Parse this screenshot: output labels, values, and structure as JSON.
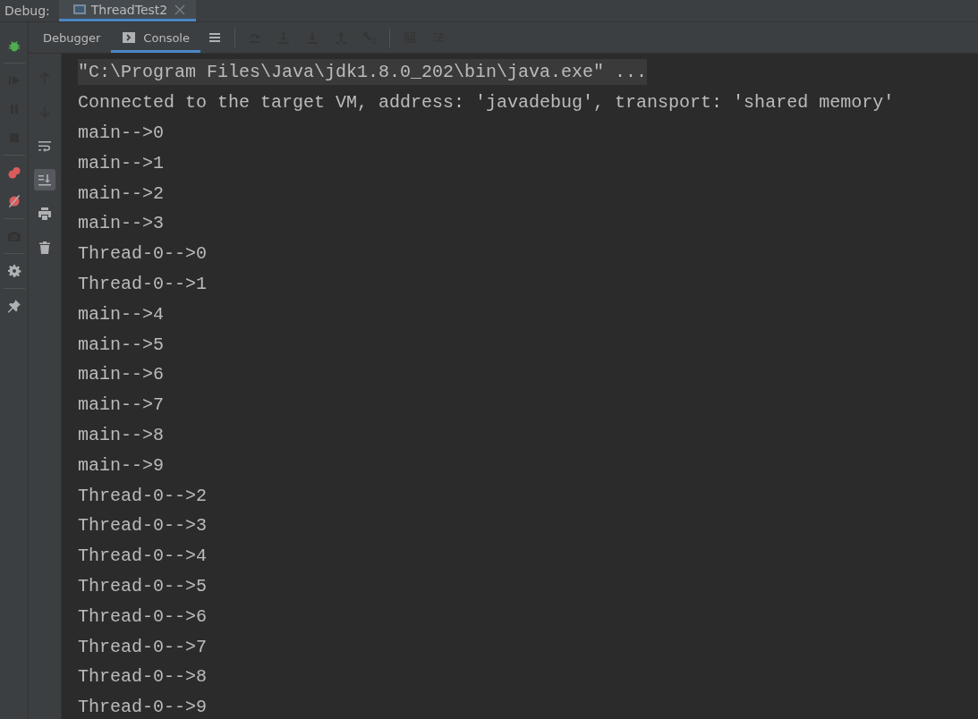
{
  "header": {
    "label": "Debug:",
    "tabs": [
      {
        "label": "ThreadTest2",
        "selected": true
      }
    ]
  },
  "tool_tabs": [
    {
      "kind": "debugger",
      "label": "Debugger",
      "selected": false
    },
    {
      "kind": "console",
      "label": "Console",
      "selected": true
    }
  ],
  "toolbar": [
    {
      "kind": "menu",
      "disabled": false
    },
    {
      "kind": "sep"
    },
    {
      "kind": "step-over",
      "disabled": true
    },
    {
      "kind": "step-into",
      "disabled": true
    },
    {
      "kind": "force-step-into",
      "disabled": true
    },
    {
      "kind": "step-out",
      "disabled": true
    },
    {
      "kind": "run-to-cursor",
      "disabled": true
    },
    {
      "kind": "sep"
    },
    {
      "kind": "evaluate",
      "disabled": true
    },
    {
      "kind": "trace",
      "disabled": true
    }
  ],
  "left_strip": [
    {
      "kind": "bug",
      "disabled": false
    },
    {
      "kind": "sep"
    },
    {
      "kind": "resume",
      "disabled": true
    },
    {
      "kind": "pause",
      "disabled": true
    },
    {
      "kind": "stop",
      "disabled": true
    },
    {
      "kind": "sep"
    },
    {
      "kind": "breakpoints",
      "disabled": false
    },
    {
      "kind": "mute",
      "disabled": false
    },
    {
      "kind": "sep"
    },
    {
      "kind": "camera",
      "disabled": true
    },
    {
      "kind": "sep"
    },
    {
      "kind": "settings",
      "disabled": false
    },
    {
      "kind": "sep"
    },
    {
      "kind": "pin",
      "disabled": false
    }
  ],
  "console_strip": [
    {
      "kind": "up",
      "on": false,
      "disabled": true
    },
    {
      "kind": "down",
      "on": false,
      "disabled": true
    },
    {
      "kind": "wrap",
      "on": false,
      "disabled": false
    },
    {
      "kind": "scroll-end",
      "on": true,
      "disabled": false
    },
    {
      "kind": "print",
      "on": false,
      "disabled": false
    },
    {
      "kind": "trash",
      "on": false,
      "disabled": false
    }
  ],
  "console": {
    "lines": [
      {
        "kind": "command",
        "text": "\"C:\\Program Files\\Java\\jdk1.8.0_202\\bin\\java.exe\" ..."
      },
      {
        "kind": "output",
        "text": "Connected to the target VM, address: 'javadebug', transport: 'shared memory'"
      },
      {
        "kind": "output",
        "text": "main-->0"
      },
      {
        "kind": "output",
        "text": "main-->1"
      },
      {
        "kind": "output",
        "text": "main-->2"
      },
      {
        "kind": "output",
        "text": "main-->3"
      },
      {
        "kind": "output",
        "text": "Thread-0-->0"
      },
      {
        "kind": "output",
        "text": "Thread-0-->1"
      },
      {
        "kind": "output",
        "text": "main-->4"
      },
      {
        "kind": "output",
        "text": "main-->5"
      },
      {
        "kind": "output",
        "text": "main-->6"
      },
      {
        "kind": "output",
        "text": "main-->7"
      },
      {
        "kind": "output",
        "text": "main-->8"
      },
      {
        "kind": "output",
        "text": "main-->9"
      },
      {
        "kind": "output",
        "text": "Thread-0-->2"
      },
      {
        "kind": "output",
        "text": "Thread-0-->3"
      },
      {
        "kind": "output",
        "text": "Thread-0-->4"
      },
      {
        "kind": "output",
        "text": "Thread-0-->5"
      },
      {
        "kind": "output",
        "text": "Thread-0-->6"
      },
      {
        "kind": "output",
        "text": "Thread-0-->7"
      },
      {
        "kind": "output",
        "text": "Thread-0-->8"
      },
      {
        "kind": "output",
        "text": "Thread-0-->9"
      }
    ]
  }
}
